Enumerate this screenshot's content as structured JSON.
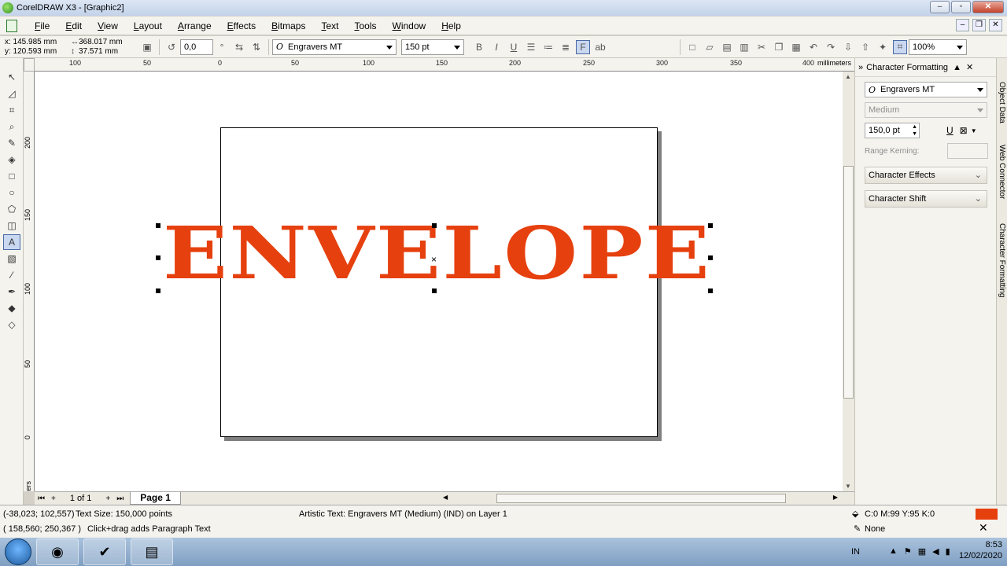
{
  "window": {
    "title": "CorelDRAW X3 - [Graphic2]",
    "minimize": "–",
    "maximize": "▫",
    "close": "✕"
  },
  "menu": [
    "File",
    "Edit",
    "View",
    "Layout",
    "Arrange",
    "Effects",
    "Bitmaps",
    "Text",
    "Tools",
    "Window",
    "Help"
  ],
  "property_bar": {
    "x": "x: 145.985 mm",
    "y": "y: 120.593 mm",
    "width": "368.017 mm",
    "height": "37.571 mm",
    "rotation": "0,0",
    "rotation_unit": "°",
    "font": "Engravers MT",
    "font_size": "150 pt",
    "zoom": "100%"
  },
  "ruler": {
    "h_labels": [
      "100",
      "50",
      "0",
      "50",
      "100",
      "150",
      "200",
      "250",
      "300",
      "350",
      "400"
    ],
    "v_labels": [
      "200",
      "150",
      "100",
      "50",
      "0"
    ],
    "units": "millimeters"
  },
  "canvas": {
    "text": "ENVELOPE",
    "text_color": "#e6400f"
  },
  "page_nav": {
    "count": "1 of 1",
    "tab": "Page 1"
  },
  "docker": {
    "title": "Character Formatting",
    "font": "Engravers MT",
    "weight": "Medium",
    "size": "150,0 pt",
    "range_kerning_label": "Range Kerning:",
    "sections": [
      "Character Effects",
      "Character Shift"
    ],
    "side_tabs": [
      "Object Data",
      "Web Connector",
      "Character Formatting"
    ]
  },
  "status": {
    "cursor1": "(-38,023; 102,557)",
    "text_size": "Text Size: 150,000 points",
    "cursor2": "( 158,560; 250,367 )",
    "hint": "Click+drag adds Paragraph Text",
    "object_info": "Artistic Text: Engravers MT (Medium) (IND) on Layer 1",
    "fill": "C:0 M:99 Y:95 K:0",
    "outline": "None",
    "fill_color": "#e6400f"
  },
  "taskbar": {
    "lang": "IN",
    "time": "8:53",
    "date": "12/02/2020"
  }
}
